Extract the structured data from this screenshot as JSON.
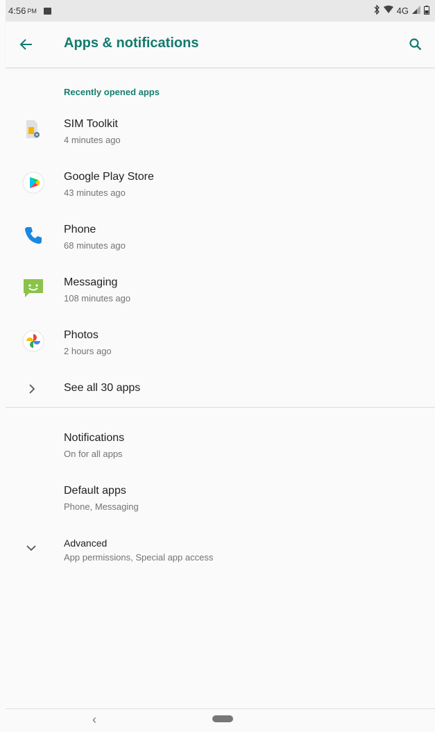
{
  "status": {
    "time": "4:56",
    "ampm": "PM",
    "network": "4G"
  },
  "toolbar": {
    "title": "Apps & notifications"
  },
  "recent": {
    "header": "Recently opened apps",
    "apps": [
      {
        "name": "SIM Toolkit",
        "time": "4 minutes ago",
        "icon": "sim-toolkit-icon"
      },
      {
        "name": "Google Play Store",
        "time": "43 minutes ago",
        "icon": "play-store-icon"
      },
      {
        "name": "Phone",
        "time": "68 minutes ago",
        "icon": "phone-icon"
      },
      {
        "name": "Messaging",
        "time": "108 minutes ago",
        "icon": "messaging-icon"
      },
      {
        "name": "Photos",
        "time": "2 hours ago",
        "icon": "photos-icon"
      }
    ],
    "see_all": "See all 30 apps"
  },
  "settings": [
    {
      "title": "Notifications",
      "subtitle": "On for all apps"
    },
    {
      "title": "Default apps",
      "subtitle": "Phone, Messaging"
    },
    {
      "title": "Advanced",
      "subtitle": "App permissions, Special app access"
    }
  ],
  "colors": {
    "accent": "#137a6e",
    "background": "#fafafa"
  }
}
